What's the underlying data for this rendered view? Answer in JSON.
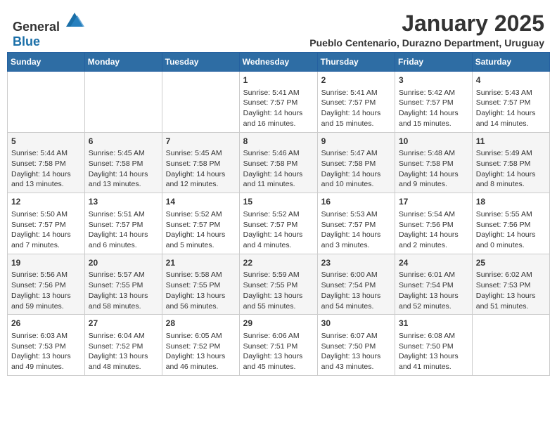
{
  "header": {
    "logo_general": "General",
    "logo_blue": "Blue",
    "month": "January 2025",
    "location": "Pueblo Centenario, Durazno Department, Uruguay"
  },
  "weekdays": [
    "Sunday",
    "Monday",
    "Tuesday",
    "Wednesday",
    "Thursday",
    "Friday",
    "Saturday"
  ],
  "weeks": [
    [
      {
        "day": "",
        "info": ""
      },
      {
        "day": "",
        "info": ""
      },
      {
        "day": "",
        "info": ""
      },
      {
        "day": "1",
        "info": "Sunrise: 5:41 AM\nSunset: 7:57 PM\nDaylight: 14 hours and 16 minutes."
      },
      {
        "day": "2",
        "info": "Sunrise: 5:41 AM\nSunset: 7:57 PM\nDaylight: 14 hours and 15 minutes."
      },
      {
        "day": "3",
        "info": "Sunrise: 5:42 AM\nSunset: 7:57 PM\nDaylight: 14 hours and 15 minutes."
      },
      {
        "day": "4",
        "info": "Sunrise: 5:43 AM\nSunset: 7:57 PM\nDaylight: 14 hours and 14 minutes."
      }
    ],
    [
      {
        "day": "5",
        "info": "Sunrise: 5:44 AM\nSunset: 7:58 PM\nDaylight: 14 hours and 13 minutes."
      },
      {
        "day": "6",
        "info": "Sunrise: 5:45 AM\nSunset: 7:58 PM\nDaylight: 14 hours and 13 minutes."
      },
      {
        "day": "7",
        "info": "Sunrise: 5:45 AM\nSunset: 7:58 PM\nDaylight: 14 hours and 12 minutes."
      },
      {
        "day": "8",
        "info": "Sunrise: 5:46 AM\nSunset: 7:58 PM\nDaylight: 14 hours and 11 minutes."
      },
      {
        "day": "9",
        "info": "Sunrise: 5:47 AM\nSunset: 7:58 PM\nDaylight: 14 hours and 10 minutes."
      },
      {
        "day": "10",
        "info": "Sunrise: 5:48 AM\nSunset: 7:58 PM\nDaylight: 14 hours and 9 minutes."
      },
      {
        "day": "11",
        "info": "Sunrise: 5:49 AM\nSunset: 7:58 PM\nDaylight: 14 hours and 8 minutes."
      }
    ],
    [
      {
        "day": "12",
        "info": "Sunrise: 5:50 AM\nSunset: 7:57 PM\nDaylight: 14 hours and 7 minutes."
      },
      {
        "day": "13",
        "info": "Sunrise: 5:51 AM\nSunset: 7:57 PM\nDaylight: 14 hours and 6 minutes."
      },
      {
        "day": "14",
        "info": "Sunrise: 5:52 AM\nSunset: 7:57 PM\nDaylight: 14 hours and 5 minutes."
      },
      {
        "day": "15",
        "info": "Sunrise: 5:52 AM\nSunset: 7:57 PM\nDaylight: 14 hours and 4 minutes."
      },
      {
        "day": "16",
        "info": "Sunrise: 5:53 AM\nSunset: 7:57 PM\nDaylight: 14 hours and 3 minutes."
      },
      {
        "day": "17",
        "info": "Sunrise: 5:54 AM\nSunset: 7:56 PM\nDaylight: 14 hours and 2 minutes."
      },
      {
        "day": "18",
        "info": "Sunrise: 5:55 AM\nSunset: 7:56 PM\nDaylight: 14 hours and 0 minutes."
      }
    ],
    [
      {
        "day": "19",
        "info": "Sunrise: 5:56 AM\nSunset: 7:56 PM\nDaylight: 13 hours and 59 minutes."
      },
      {
        "day": "20",
        "info": "Sunrise: 5:57 AM\nSunset: 7:55 PM\nDaylight: 13 hours and 58 minutes."
      },
      {
        "day": "21",
        "info": "Sunrise: 5:58 AM\nSunset: 7:55 PM\nDaylight: 13 hours and 56 minutes."
      },
      {
        "day": "22",
        "info": "Sunrise: 5:59 AM\nSunset: 7:55 PM\nDaylight: 13 hours and 55 minutes."
      },
      {
        "day": "23",
        "info": "Sunrise: 6:00 AM\nSunset: 7:54 PM\nDaylight: 13 hours and 54 minutes."
      },
      {
        "day": "24",
        "info": "Sunrise: 6:01 AM\nSunset: 7:54 PM\nDaylight: 13 hours and 52 minutes."
      },
      {
        "day": "25",
        "info": "Sunrise: 6:02 AM\nSunset: 7:53 PM\nDaylight: 13 hours and 51 minutes."
      }
    ],
    [
      {
        "day": "26",
        "info": "Sunrise: 6:03 AM\nSunset: 7:53 PM\nDaylight: 13 hours and 49 minutes."
      },
      {
        "day": "27",
        "info": "Sunrise: 6:04 AM\nSunset: 7:52 PM\nDaylight: 13 hours and 48 minutes."
      },
      {
        "day": "28",
        "info": "Sunrise: 6:05 AM\nSunset: 7:52 PM\nDaylight: 13 hours and 46 minutes."
      },
      {
        "day": "29",
        "info": "Sunrise: 6:06 AM\nSunset: 7:51 PM\nDaylight: 13 hours and 45 minutes."
      },
      {
        "day": "30",
        "info": "Sunrise: 6:07 AM\nSunset: 7:50 PM\nDaylight: 13 hours and 43 minutes."
      },
      {
        "day": "31",
        "info": "Sunrise: 6:08 AM\nSunset: 7:50 PM\nDaylight: 13 hours and 41 minutes."
      },
      {
        "day": "",
        "info": ""
      }
    ]
  ]
}
